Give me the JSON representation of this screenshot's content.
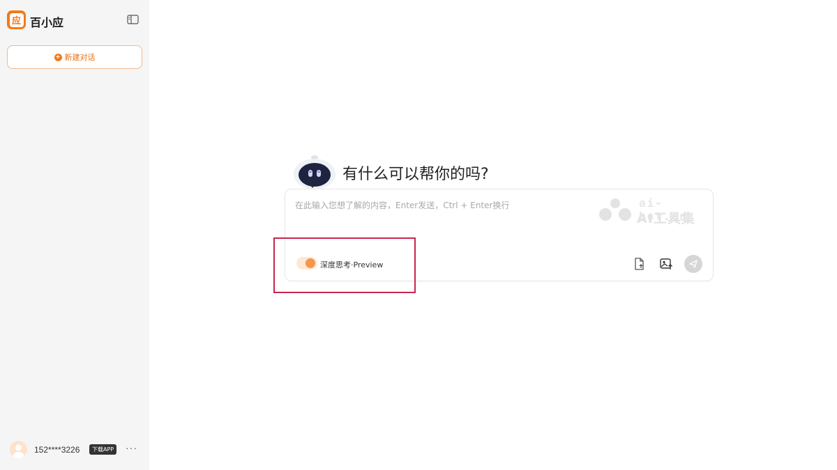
{
  "app": {
    "name": "百小应",
    "logo_char": "应"
  },
  "sidebar": {
    "new_chat_label": "新建对话",
    "user": {
      "phone": "152****3226",
      "app_badge": "下载APP",
      "more": "···"
    }
  },
  "main": {
    "greeting": "有什么可以帮你的吗?",
    "input": {
      "placeholder": "在此输入您想了解的内容，Enter发送，Ctrl + Enter换行",
      "value": ""
    },
    "deep_think": {
      "label": "深度思考·Preview",
      "enabled": true
    },
    "tools": [
      "upload-file-icon",
      "upload-image-icon",
      "send-icon"
    ]
  },
  "watermark": {
    "url": "ai-bot.cn",
    "title": "AI工具集"
  },
  "colors": {
    "accent": "#f27a1a",
    "sidebar_bg": "#f5f5f5",
    "highlight": "#c8254f"
  }
}
